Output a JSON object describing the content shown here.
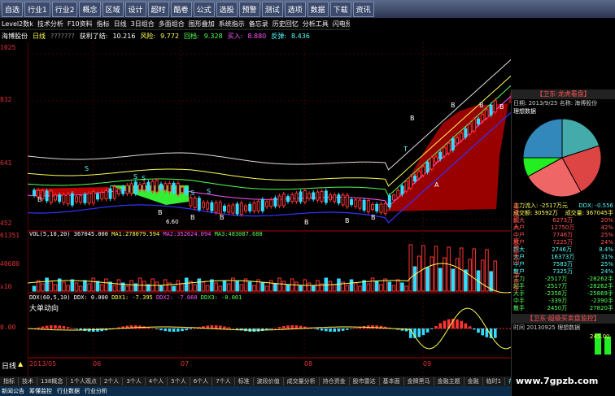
{
  "topbar": {
    "buttons": [
      "自选",
      "行业1",
      "行业2",
      "概念",
      "区域",
      "设计",
      "超时",
      "酷卷",
      "公式",
      "选股",
      "预警",
      "测试",
      "选项",
      "数据",
      "下载",
      "资讯"
    ]
  },
  "toolbar2": [
    "Level2数k",
    "技术分析",
    "F10资料",
    "指标",
    "日线",
    "3日组合",
    "多面组合",
    "图形叠加",
    "系统指示",
    "备忘录",
    "历史回忆",
    "分析工具",
    "闪电预警",
    "坐标"
  ],
  "topinfo": {
    "stock": "海博股份",
    "period": "日线",
    "prefix": "???????",
    "indicator": "获利了结:",
    "v1": "10.216",
    "l2": "风险:",
    "v2": "9.772",
    "l3": "回档:",
    "v3": "9.328",
    "l4": "买入:",
    "v4": "8.880",
    "l5": "反弹:",
    "v5": "8.436"
  },
  "price_axis": [
    "1025",
    "832",
    "641",
    "452"
  ],
  "vol_axis": [
    "61351",
    "40680",
    "x10"
  ],
  "vol_info": {
    "title": "VOL(5,10,20)",
    "v": "367045.000",
    "ma1_l": "MA1:",
    "ma1": "278079.594",
    "ma2_l": "MA2:",
    "ma2": "352624.094",
    "ma3_l": "MA3:",
    "ma3": "483087.688"
  },
  "ddx_info": {
    "title": "DDX(60,5,10)",
    "ddx": "DDX: 0.000",
    "ddx1": "DDX1: -7.395",
    "ddx2": "DDX2: -7.060",
    "ddx3": "DDX3: -0.001"
  },
  "ddx_label": "大单动向",
  "ddx_axis": [
    "0.00"
  ],
  "date_axis": {
    "period": "日线",
    "labels": [
      "2013/05",
      "06",
      "07",
      "08",
      "09"
    ]
  },
  "annotations": {
    "s_labels": [
      "S",
      "S",
      "S",
      "S",
      "S"
    ],
    "b_labels": [
      "B",
      "B",
      "B",
      "B",
      "B",
      "B",
      "B",
      "B",
      "B",
      "B",
      "B"
    ],
    "t_label": "T",
    "low_label": "6.60",
    "a_label": "A"
  },
  "bottom_tabs": [
    "指标",
    "技术",
    "138概念",
    "1个人观点",
    "2个人",
    "3个人",
    "4个人",
    "5个人",
    "6个人",
    "7个人",
    "标准",
    "波段价值",
    "成交量分析",
    "持仓资金",
    "股市雷达",
    "基本面",
    "金牌黑马",
    "金融主题",
    "金融",
    "临时1",
    "存为模板"
  ],
  "bottom_tabs2": [
    "新闻公告",
    "筹懂监控",
    "行业数据",
    "行业分析"
  ],
  "right_panel": {
    "title": "【卫东·龙虎看盘】",
    "date_row": "日期: 2013/9/25  名称: 海博股份",
    "section": "理想数据",
    "legend1": "主力流入: -2517万元",
    "legend1b": "DDX: -0.556",
    "legend2": "成交额: 30592万",
    "legend2b": "成交量: 367045手",
    "rows_a": [
      [
        "超大",
        "6273万",
        "20%"
      ],
      [
        "大户",
        "12750万",
        "42%"
      ],
      [
        "中户",
        "7746万",
        "25%"
      ],
      [
        "散户",
        "7225万",
        "24%"
      ]
    ],
    "rows_b": [
      [
        "超大",
        "2746万",
        "8.4%"
      ],
      [
        "大户",
        "16373万",
        "31%"
      ],
      [
        "中户",
        "7583万",
        "25%"
      ],
      [
        "散户",
        "7325万",
        "24%"
      ]
    ],
    "rows_c": [
      [
        "主力",
        "-2517万",
        "-28262手"
      ],
      [
        "超手",
        "-2517万",
        "-28262手"
      ],
      [
        "大手",
        "-2358万",
        "-25869手"
      ],
      [
        "中手",
        "-339万",
        "-2390手"
      ],
      [
        "散手",
        "2450万",
        "27820手"
      ]
    ],
    "vert_buy": "资金买入",
    "vert_sell": "资金卖出",
    "vert_net": "净资金",
    "panel2_title": "【卫东·超级买卖盘监控】",
    "panel2_row": "时间  20130925  理想数据",
    "panel2_val": "245.00"
  },
  "watermark": "www.7gpzb.com",
  "colors": {
    "up": "#ff3333",
    "down": "#33ddff",
    "band": "#aa0000",
    "green": "#22ee22"
  }
}
